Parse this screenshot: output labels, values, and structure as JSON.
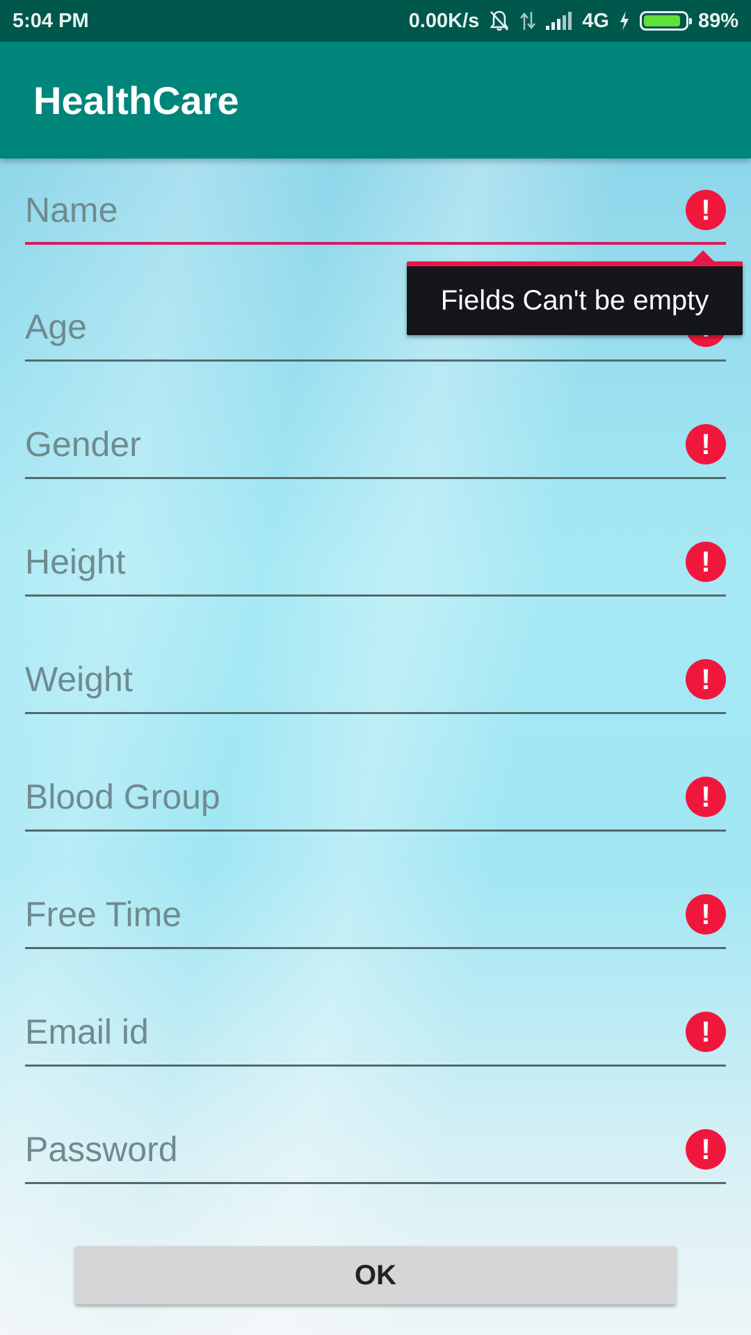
{
  "status_bar": {
    "time": "5:04 PM",
    "network_speed": "0.00K/s",
    "network_type": "4G",
    "battery_percent": "89%",
    "battery_level": 0.89,
    "icons": [
      "mute-bell-icon",
      "data-transfer-icon",
      "signal-icon",
      "charging-icon",
      "battery-icon"
    ]
  },
  "app_bar": {
    "title": "HealthCare"
  },
  "form": {
    "fields": [
      {
        "placeholder": "Name",
        "value": "",
        "error": true
      },
      {
        "placeholder": "Age",
        "value": "",
        "error": true
      },
      {
        "placeholder": "Gender",
        "value": "",
        "error": true
      },
      {
        "placeholder": "Height",
        "value": "",
        "error": true
      },
      {
        "placeholder": "Weight",
        "value": "",
        "error": true
      },
      {
        "placeholder": "Blood Group",
        "value": "",
        "error": true
      },
      {
        "placeholder": "Free Time",
        "value": "",
        "error": true
      },
      {
        "placeholder": "Email id",
        "value": "",
        "error": true
      },
      {
        "placeholder": "Password",
        "value": "",
        "error": true
      }
    ],
    "error_tooltip": "Fields Can't be empty",
    "error_icon_glyph": "!",
    "ok_label": "OK"
  },
  "colors": {
    "status_bar": "#00574b",
    "app_bar": "#00857a",
    "error": "#f0173d",
    "active_underline": "#d81b60"
  }
}
